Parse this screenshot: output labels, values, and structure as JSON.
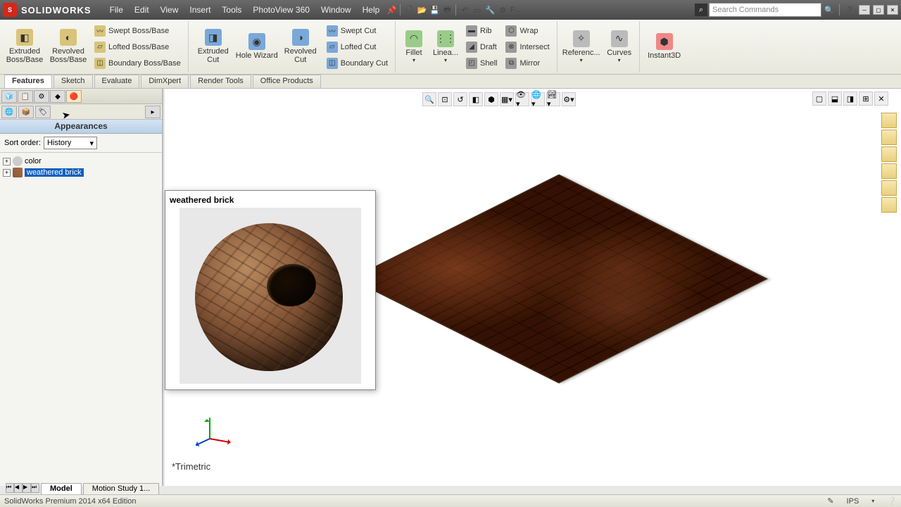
{
  "app": {
    "brand": "SOLIDWORKS"
  },
  "menu": [
    "File",
    "Edit",
    "View",
    "Insert",
    "Tools",
    "PhotoView 360",
    "Window",
    "Help"
  ],
  "toolbar_right": {
    "search_placeholder": "Search Commands",
    "f_label": "F..."
  },
  "ribbon": {
    "extruded_boss": "Extruded Boss/Base",
    "revolved_boss": "Revolved Boss/Base",
    "swept_boss": "Swept Boss/Base",
    "lofted_boss": "Lofted Boss/Base",
    "boundary_boss": "Boundary Boss/Base",
    "extruded_cut": "Extruded Cut",
    "hole_wizard": "Hole Wizard",
    "revolved_cut": "Revolved Cut",
    "swept_cut": "Swept Cut",
    "lofted_cut": "Lofted Cut",
    "boundary_cut": "Boundary Cut",
    "fillet": "Fillet",
    "linear": "Linea...",
    "rib": "Rib",
    "draft": "Draft",
    "shell": "Shell",
    "wrap": "Wrap",
    "intersect": "Intersect",
    "mirror": "Mirror",
    "reference": "Referenc...",
    "curves": "Curves",
    "instant3d": "Instant3D"
  },
  "cmd_tabs": [
    "Features",
    "Sketch",
    "Evaluate",
    "DimXpert",
    "Render Tools",
    "Office Products"
  ],
  "panel": {
    "title": "Appearances",
    "sort_label": "Sort order:",
    "sort_value": "History",
    "items": [
      {
        "label": "color"
      },
      {
        "label": "weathered brick"
      }
    ]
  },
  "preview": {
    "title": "weathered brick"
  },
  "triad_label": "*Trimetric",
  "bottom_tabs": {
    "model": "Model",
    "motion": "Motion Study 1..."
  },
  "status": {
    "edition": "SolidWorks Premium 2014 x64 Edition",
    "units": "IPS"
  }
}
